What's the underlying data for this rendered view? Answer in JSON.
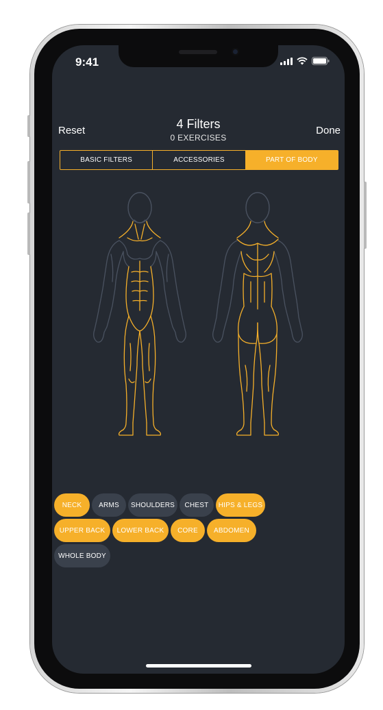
{
  "status_bar": {
    "time": "9:41"
  },
  "header": {
    "reset_label": "Reset",
    "title": "4 Filters",
    "subtitle": "0 EXERCISES",
    "done_label": "Done"
  },
  "tabs": [
    {
      "label": "BASIC FILTERS",
      "active": false
    },
    {
      "label": "ACCESSORIES",
      "active": false
    },
    {
      "label": "PART OF BODY",
      "active": true
    }
  ],
  "body_parts": [
    {
      "label": "NECK",
      "selected": true
    },
    {
      "label": "ARMS",
      "selected": false
    },
    {
      "label": "SHOULDERS",
      "selected": false
    },
    {
      "label": "CHEST",
      "selected": false
    },
    {
      "label": "HIPS & LEGS",
      "selected": true
    },
    {
      "label": "UPPER BACK",
      "selected": true
    },
    {
      "label": "LOWER BACK",
      "selected": true
    },
    {
      "label": "CORE",
      "selected": true
    },
    {
      "label": "ABDOMEN",
      "selected": true
    },
    {
      "label": "WHOLE BODY",
      "selected": false
    }
  ],
  "colors": {
    "accent": "#f6b02a",
    "background": "#252a32",
    "chip_inactive": "#3a414c",
    "outline_inactive": "#4a5260"
  },
  "icons": [
    "signal-icon",
    "wifi-icon",
    "battery-icon",
    "body-front-figure",
    "body-back-figure"
  ]
}
